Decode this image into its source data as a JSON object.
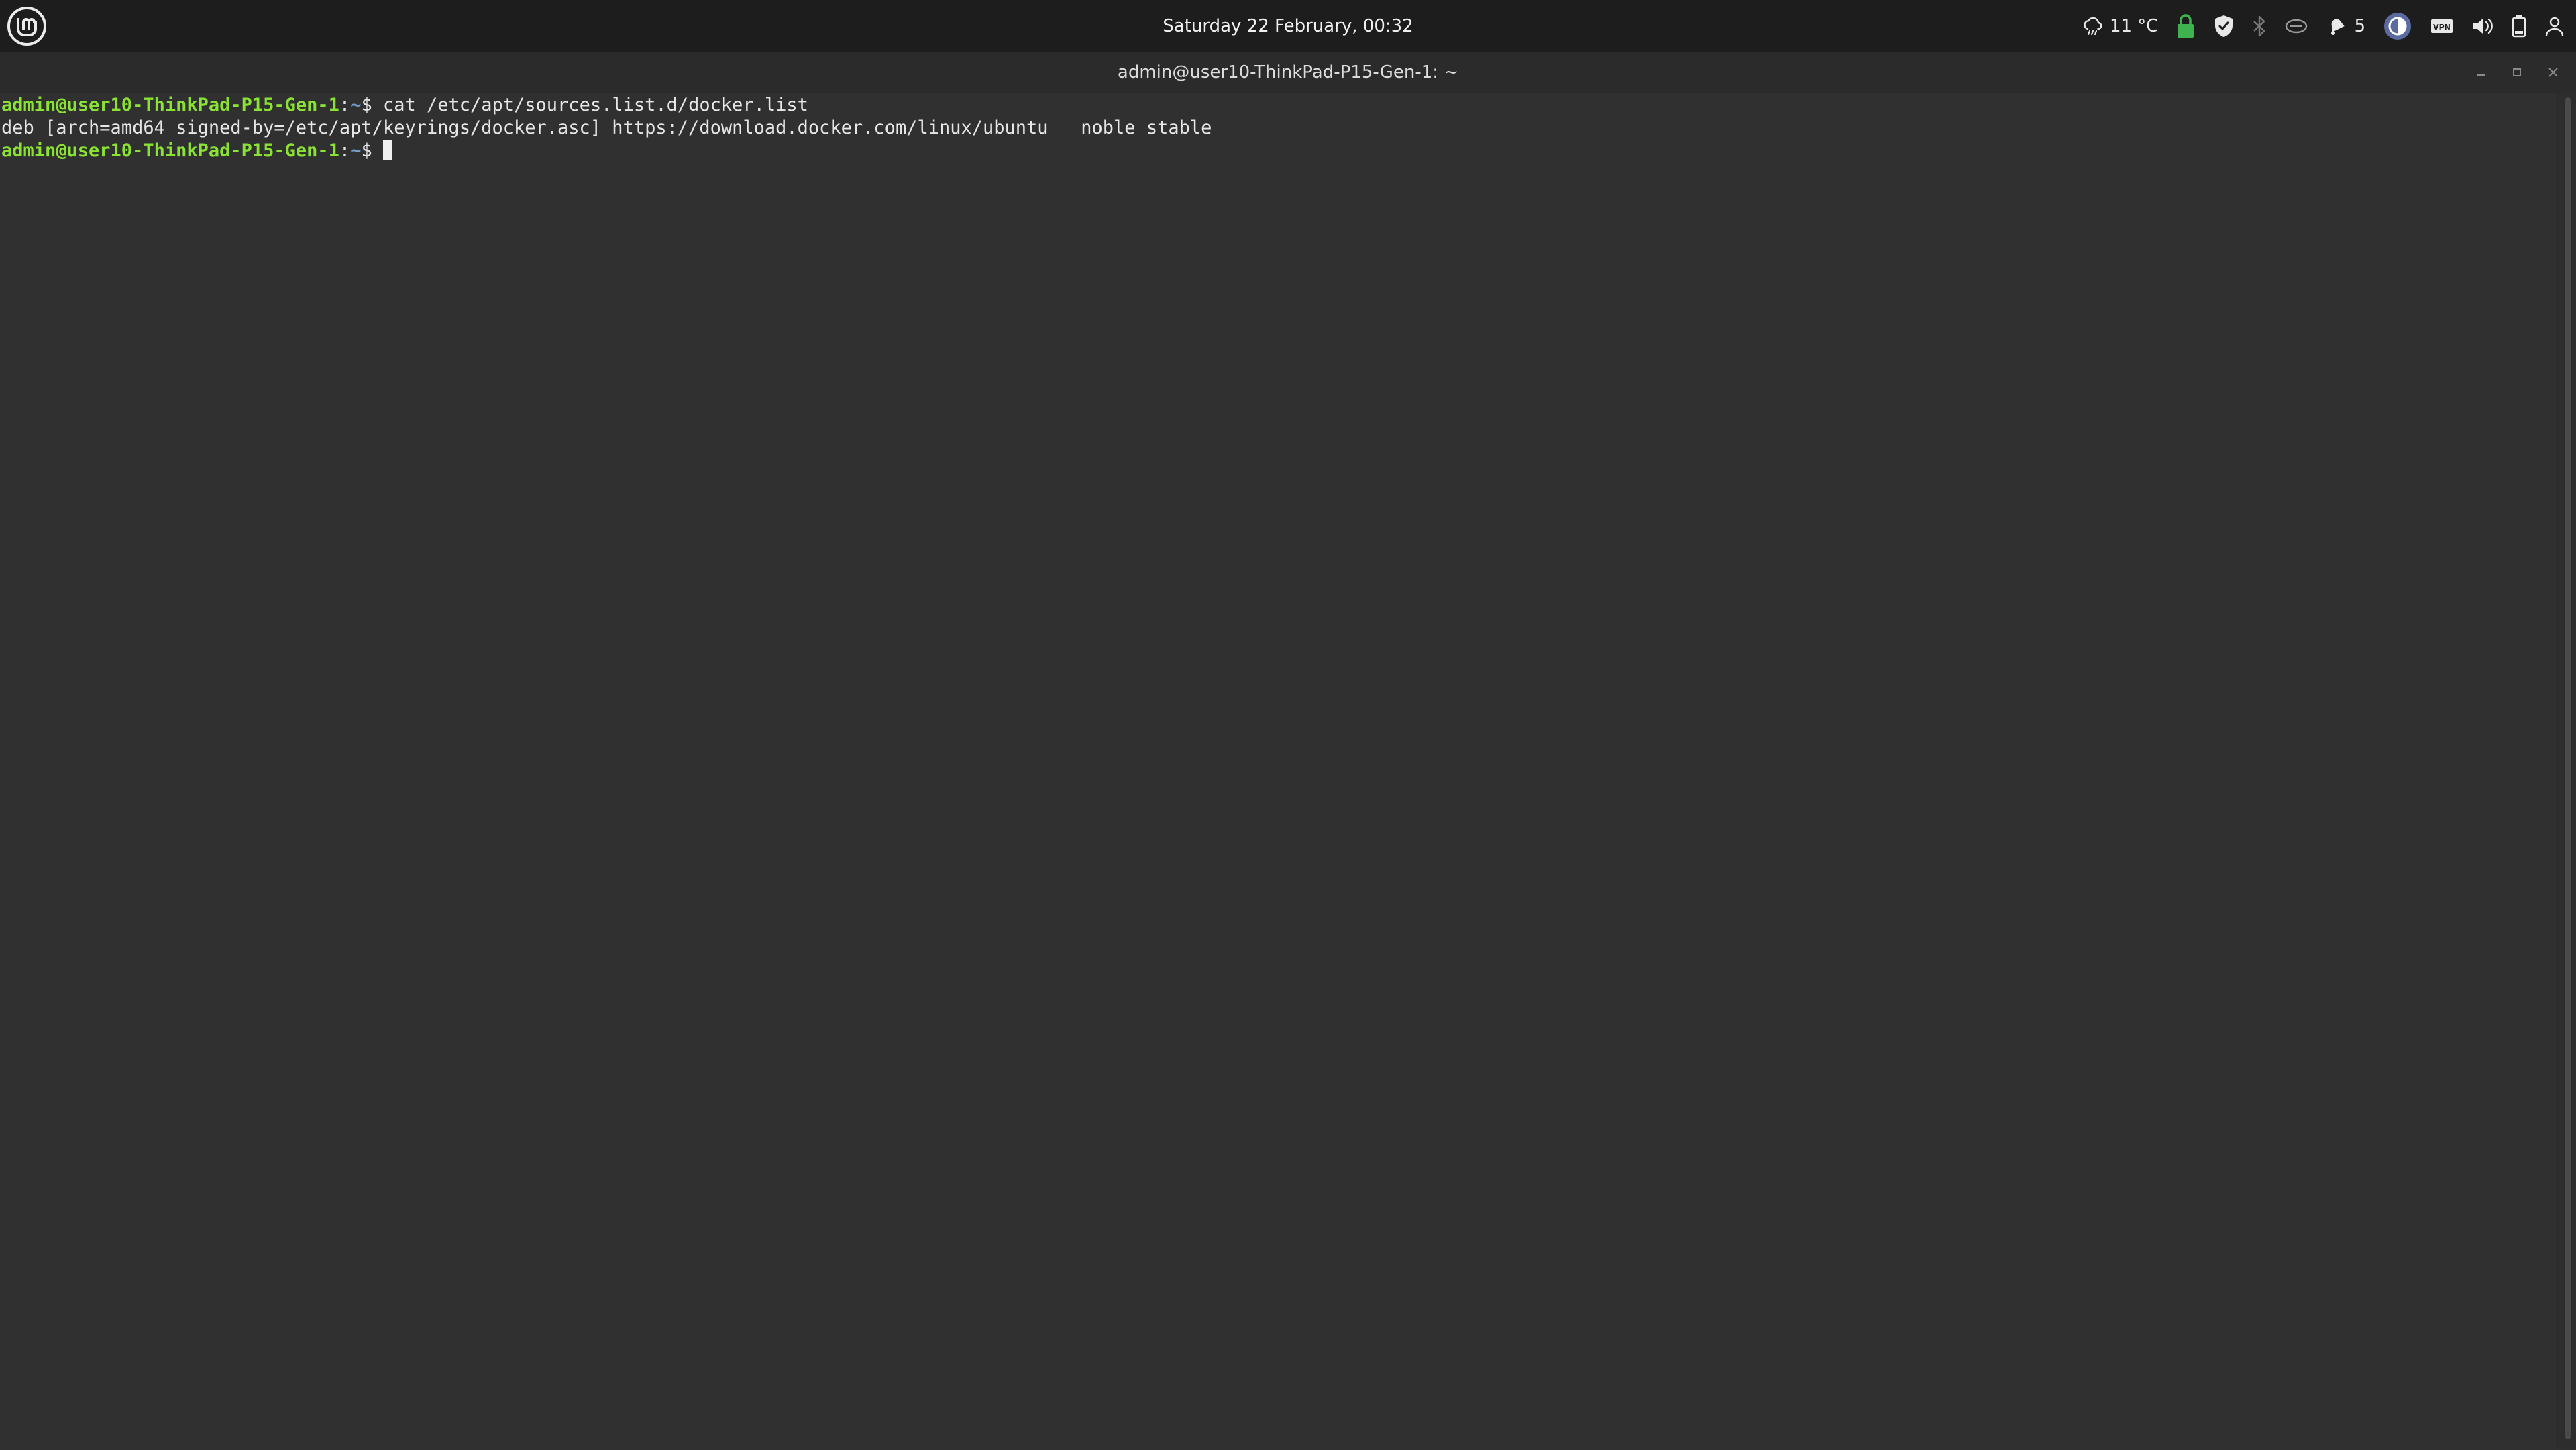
{
  "topbar": {
    "clock": "Saturday 22 February, 00:32",
    "weather_temp": "11 °C",
    "notification_count": "5",
    "accent_green": "#3fb34f",
    "icons": [
      "linux-mint-logo-icon",
      "weather-icon",
      "lock-icon",
      "shield-icon",
      "bluetooth-icon",
      "network-icon",
      "notifications-icon",
      "display-icon",
      "vpn-icon",
      "volume-icon",
      "battery-icon",
      "user-icon"
    ]
  },
  "window": {
    "title": "admin@user10-ThinkPad-P15-Gen-1: ~"
  },
  "terminal": {
    "lines": [
      {
        "user_host": "admin@user10-ThinkPad-P15-Gen-1",
        "path": "~",
        "command": "cat /etc/apt/sources.list.d/docker.list"
      },
      {
        "output": "deb [arch=amd64 signed-by=/etc/apt/keyrings/docker.asc] https://download.docker.com/linux/ubuntu   noble stable"
      },
      {
        "user_host": "admin@user10-ThinkPad-P15-Gen-1",
        "path": "~",
        "command": ""
      }
    ],
    "colors": {
      "user_host": "#8ae234",
      "path": "#729fcf",
      "background": "#303030"
    }
  }
}
